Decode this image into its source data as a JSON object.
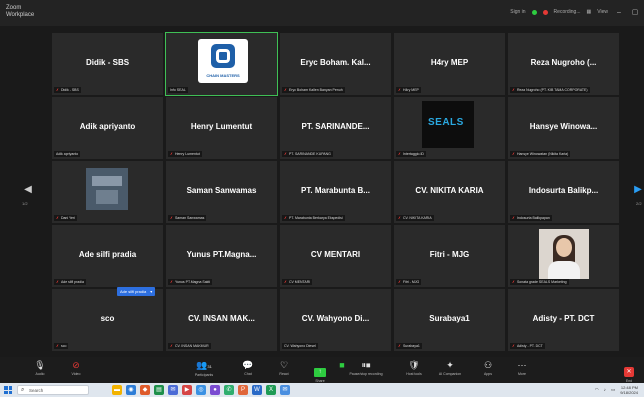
{
  "window": {
    "app_title": "Zoom Workplace",
    "signin": "Sign in",
    "recording": "Recording...",
    "view": "View",
    "status_colors": {
      "recording": "#e53935",
      "active": "#2ecc40"
    }
  },
  "tiles": [
    {
      "name": "Didik - SBS",
      "label": "Didik - SBS",
      "muted": true
    },
    {
      "name": "",
      "label": "Info SEAL",
      "muted": false,
      "video": "logo",
      "brand": "CHAIN MASTERS",
      "active": true
    },
    {
      "name": "Eryc Boham. Kal...",
      "label": "Eryc Boham Kallen Banyan Penuh",
      "muted": true
    },
    {
      "name": "H4ry MEP",
      "label": "H4ry MEP",
      "muted": true
    },
    {
      "name": "Reza Nugroho (...",
      "label": "Reza Nugroho (PT. KIB TAMA CORPORATE)",
      "muted": true
    },
    {
      "name": "Adik apriyanto",
      "label": "Adik apriyanto",
      "muted": false
    },
    {
      "name": "Henry Lumentut",
      "label": "Henry Lumentut",
      "muted": true
    },
    {
      "name": "PT. SARINANDE...",
      "label": "PT. SARINANDE KUPANG",
      "muted": true
    },
    {
      "name": "",
      "label": "Intertaggio.ID",
      "muted": true,
      "video": "seals",
      "brand": "SEALS"
    },
    {
      "name": "Hansye Winowa...",
      "label": "Hansye Winowatan (Nikita Karia)",
      "muted": true
    },
    {
      "name": "",
      "label": "Dani Yeri",
      "muted": true,
      "video": "desk"
    },
    {
      "name": "Saman Sanwamas",
      "label": "Saman Sanwamas",
      "muted": true
    },
    {
      "name": "PT. Marabunta B...",
      "label": "PT. Marabunta Berkarya Ekspedisi",
      "muted": true
    },
    {
      "name": "CV. NIKITA KARIA",
      "label": "CV. NIKITA KARIA",
      "muted": true
    },
    {
      "name": "Indosurta Balikp...",
      "label": "Indosurta Balikpapan",
      "muted": true
    },
    {
      "name": "Ade silfi pradia",
      "label": "Ade silfi pradia",
      "muted": true
    },
    {
      "name": "Yunus PT.Magna...",
      "label": "Yunus PT.Magna Sakti",
      "muted": true
    },
    {
      "name": "CV MENTARI",
      "label": "CV MENTARI",
      "muted": true
    },
    {
      "name": "Fitri - MJG",
      "label": "Fitri - MJG",
      "muted": true
    },
    {
      "name": "",
      "label": "Sonata grade SEALS Marketing",
      "muted": true,
      "video": "person"
    },
    {
      "name": "sco",
      "label": "sco",
      "muted": true
    },
    {
      "name": "CV. INSAN MAK...",
      "label": "CV. INSAN MAKMUR",
      "muted": true
    },
    {
      "name": "CV. Wahyono Di...",
      "label": "CV. Wahyono Diesel",
      "muted": false
    },
    {
      "name": "Surabaya1",
      "label": "Surabaya1",
      "muted": true
    },
    {
      "name": "Adisty - PT. DCT",
      "label": "Adisty - PT. DCT",
      "muted": true
    }
  ],
  "tooltip": {
    "text": "Ade silfi pradia"
  },
  "pager": {
    "left": "1/2",
    "right": "2/2"
  },
  "toolbar": {
    "audio": "Audio",
    "video": "Video",
    "participants": "Participants",
    "participants_count": "31",
    "chat": "Chat",
    "react": "React",
    "share": "Share",
    "pause_recording": "Pause/stop recording",
    "host_tools": "Host tools",
    "ai_companion": "AI Companion",
    "apps": "Apps",
    "more": "More",
    "end": "End"
  },
  "taskbar": {
    "search_placeholder": "Search",
    "time": "12:48 PM",
    "date": "9/18/2024"
  }
}
